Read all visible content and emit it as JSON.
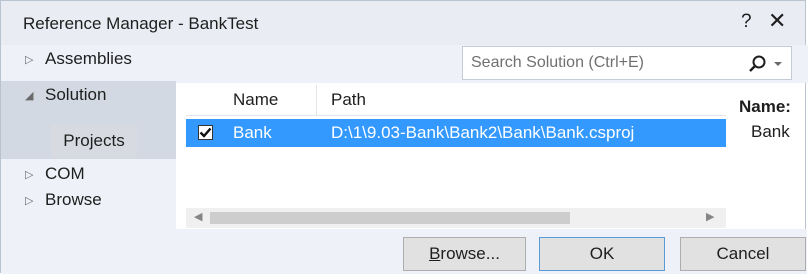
{
  "window": {
    "title": "Reference Manager - BankTest",
    "help_glyph": "?",
    "close_glyph": "✕"
  },
  "nav": {
    "assemblies": "Assemblies",
    "solution": "Solution",
    "projects": "Projects",
    "com": "COM",
    "browse": "Browse"
  },
  "search": {
    "placeholder": "Search Solution (Ctrl+E)"
  },
  "grid": {
    "columns": [
      "Name",
      "Path"
    ],
    "rows": [
      {
        "checked": true,
        "name": "Bank",
        "path": "D:\\1\\9.03-Bank\\Bank2\\Bank\\Bank.csproj"
      }
    ]
  },
  "detail": {
    "label": "Name:",
    "value": "Bank"
  },
  "buttons": {
    "browse_prefix": "B",
    "browse_rest": "rowse...",
    "ok": "OK",
    "cancel": "Cancel"
  },
  "colors": {
    "selection": "#3399ff",
    "accent_border": "#5b9bd5"
  },
  "icons": {
    "search": "search-icon",
    "dropdown": "chevron-down-icon"
  }
}
